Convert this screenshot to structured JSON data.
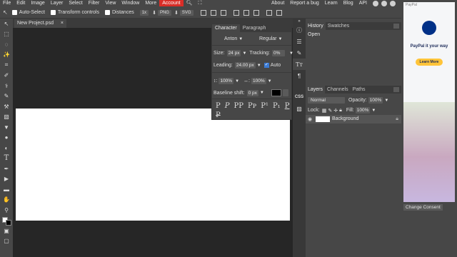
{
  "menubar": {
    "items": [
      "File",
      "Edit",
      "Image",
      "Layer",
      "Select",
      "Filter",
      "View",
      "Window",
      "More",
      "Account"
    ],
    "right_links": [
      "About",
      "Report a bug",
      "Learn",
      "Blog",
      "API"
    ],
    "accent": "#d92d27"
  },
  "options": {
    "auto_select": "Auto-Select",
    "transform_controls": "Transform controls",
    "distances": "Distances",
    "zoom": "1x",
    "png": "PNG",
    "svg": "SVG"
  },
  "document": {
    "tab_name": "New Project.psd",
    "close": "×"
  },
  "character": {
    "tabs": [
      "Character",
      "Paragraph"
    ],
    "font": "Anton",
    "style": "Regular",
    "size_label": "Size:",
    "size": "24 px",
    "tracking_label": "Tracking:",
    "tracking": "0%",
    "leading_label": "Leading:",
    "leading": "24.00 px",
    "auto_label": "Auto",
    "hscale_prefix": "↕:",
    "hscale": "100%",
    "vscale_prefix": "↔:",
    "vscale": "100%",
    "baseline_label": "Baseline shift:",
    "baseline": "0 px"
  },
  "history": {
    "tabs": [
      "History",
      "Swatches"
    ],
    "items": [
      "Open"
    ]
  },
  "layers": {
    "tabs": [
      "Layers",
      "Channels",
      "Paths"
    ],
    "blend_mode": "Normal",
    "opacity_label": "Opacity:",
    "opacity": "100%",
    "lock_label": "Lock:",
    "fill_label": "Fill:",
    "fill": "100%",
    "rows": [
      {
        "name": "Background"
      }
    ]
  },
  "ad": {
    "brand": "PayPal",
    "headline": "PayPal it your way",
    "cta": "Learn More",
    "consent": "Change Consent"
  }
}
